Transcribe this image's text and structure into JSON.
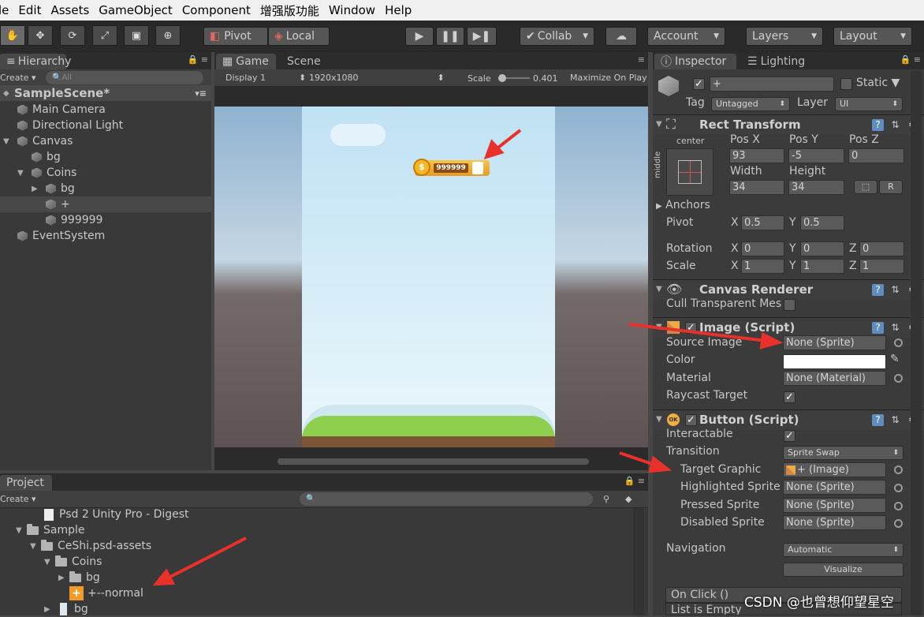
{
  "menu": [
    "le",
    "Edit",
    "Assets",
    "GameObject",
    "Component",
    "增强版功能",
    "Window",
    "Help"
  ],
  "toolbar": {
    "pivot": "Pivot",
    "local": "Local",
    "collab": "Collab",
    "account": "Account",
    "layers": "Layers",
    "layout": "Layout"
  },
  "hierarchy": {
    "tab": "Hierarchy",
    "create": "Create",
    "search_placeholder": "All",
    "scene": "SampleScene*",
    "items": [
      "Main Camera",
      "Directional Light",
      "Canvas",
      "bg",
      "Coins",
      "bg",
      "+",
      "999999",
      "EventSystem"
    ]
  },
  "game": {
    "tab_game": "Game",
    "tab_scene": "Scene",
    "display": "Display 1",
    "resolution": "1920x1080",
    "scale_label": "Scale",
    "scale_value": "0.401",
    "maximize": "Maximize On Play",
    "coin_value": "999999"
  },
  "inspector": {
    "tab": "Inspector",
    "tab_lighting": "Lighting",
    "name": "+",
    "static": "Static",
    "tag_label": "Tag",
    "tag": "Untagged",
    "layer_label": "Layer",
    "layer": "UI",
    "rect": {
      "title": "Rect Transform",
      "anchor_h": "center",
      "anchor_v": "middle",
      "posx_label": "Pos X",
      "posy_label": "Pos Y",
      "posz_label": "Pos Z",
      "posx": "93",
      "posy": "-5",
      "posz": "0",
      "width_label": "Width",
      "height_label": "Height",
      "width": "34",
      "height": "34",
      "r": "R",
      "anchors": "Anchors",
      "pivot": "Pivot",
      "pivot_x": "0.5",
      "pivot_y": "0.5",
      "rotation": "Rotation",
      "rot_x": "0",
      "rot_y": "0",
      "rot_z": "0",
      "scale": "Scale",
      "scale_x": "1",
      "scale_y": "1",
      "scale_z": "1",
      "x": "X",
      "y": "Y",
      "z": "Z"
    },
    "canvas_renderer": {
      "title": "Canvas Renderer",
      "cull": "Cull Transparent Mes"
    },
    "image": {
      "title": "Image (Script)",
      "source_label": "Source Image",
      "source": "None (Sprite)",
      "color_label": "Color",
      "material_label": "Material",
      "material": "None (Material)",
      "raycast": "Raycast Target",
      "color": "#ffffff"
    },
    "button": {
      "title": "Button (Script)",
      "interactable": "Interactable",
      "transition_label": "Transition",
      "transition": "Sprite Swap",
      "target_label": "Target Graphic",
      "target": "+ (Image)",
      "highlighted_label": "Highlighted Sprite",
      "highlighted": "None (Sprite)",
      "pressed_label": "Pressed Sprite",
      "pressed": "None (Sprite)",
      "disabled_label": "Disabled Sprite",
      "disabled": "None (Sprite)",
      "navigation_label": "Navigation",
      "navigation": "Automatic",
      "visualize": "Visualize",
      "onclick": "On Click ()",
      "list_empty": "List is Empty"
    }
  },
  "project": {
    "tab": "Project",
    "create": "Create",
    "items": [
      "Psd 2 Unity Pro - Digest",
      "Sample",
      "CeShi.psd-assets",
      "Coins",
      "bg",
      "+--normal",
      "bg"
    ]
  },
  "watermark": "CSDN @也曾想仰望星空",
  "colors": {
    "arrow": "#e8312a",
    "sky_top": "#cfe9f5",
    "accent": "#5f8dbf"
  }
}
